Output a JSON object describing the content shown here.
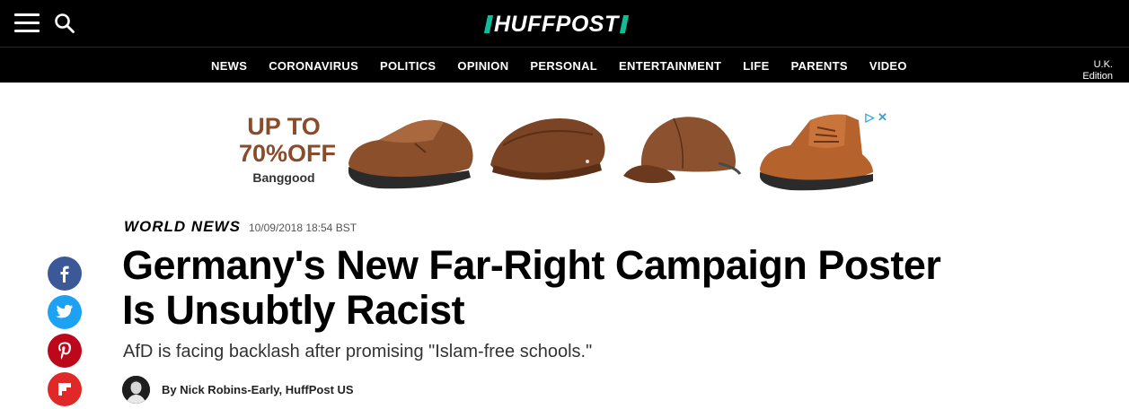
{
  "header": {
    "logo_text": "HUFFPOST",
    "menu_icon": "hamburger-menu-icon",
    "search_icon": "search-icon"
  },
  "nav": {
    "items": [
      "NEWS",
      "CORONAVIRUS",
      "POLITICS",
      "OPINION",
      "PERSONAL",
      "ENTERTAINMENT",
      "LIFE",
      "PARENTS",
      "VIDEO"
    ],
    "edition_line1": "U.K.",
    "edition_line2": "Edition"
  },
  "ad": {
    "promo_line1": "UP TO",
    "promo_line2": "70%OFF",
    "brand": "Banggood",
    "products": [
      "shoe",
      "flat-cap",
      "baseball-cap",
      "boot"
    ]
  },
  "article": {
    "section": "WORLD NEWS",
    "timestamp": "10/09/2018 18:54 BST",
    "headline_line1": "Germany's New Far-Right Campaign Poster",
    "headline_line2": "Is Unsubtly Racist",
    "subhead": "AfD is facing backlash after promising \"Islam-free schools.\"",
    "byline": "By Nick Robins-Early, HuffPost US"
  },
  "share": {
    "buttons": [
      {
        "name": "facebook",
        "color": "#3b5998"
      },
      {
        "name": "twitter",
        "color": "#1da1f2"
      },
      {
        "name": "pinterest",
        "color": "#bd081c"
      },
      {
        "name": "flipboard",
        "color": "#e12828"
      }
    ]
  },
  "colors": {
    "brand_green": "#0dbe98",
    "header_bg": "#000000",
    "ad_text": "#8a4b2a"
  }
}
